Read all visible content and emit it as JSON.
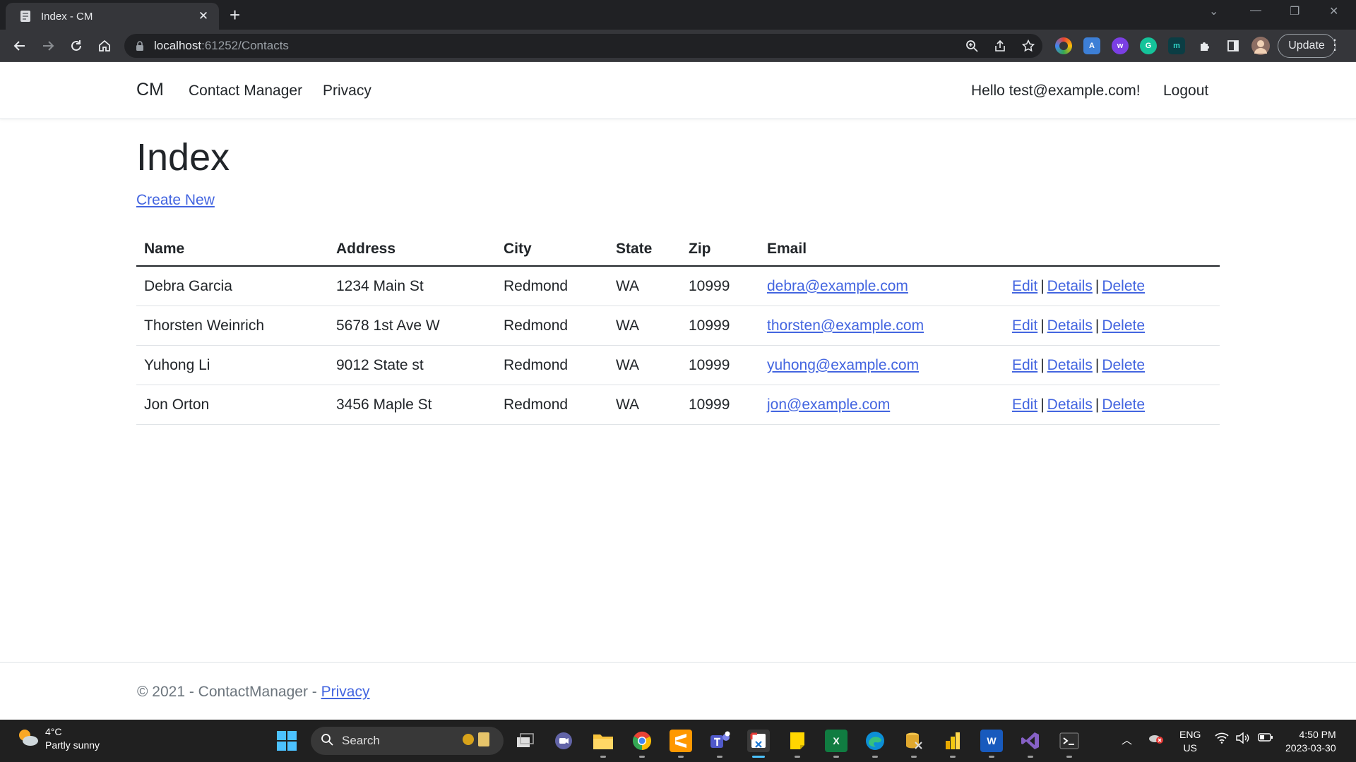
{
  "browser": {
    "tab_title": "Index - CM",
    "url_host": "localhost",
    "url_path": ":61252/Contacts",
    "update_label": "Update"
  },
  "site": {
    "brand": "CM",
    "nav": [
      "Contact Manager",
      "Privacy"
    ],
    "greeting": "Hello test@example.com!",
    "logout": "Logout"
  },
  "page": {
    "title": "Index",
    "create_new": "Create New",
    "columns": [
      "Name",
      "Address",
      "City",
      "State",
      "Zip",
      "Email"
    ],
    "contacts": [
      {
        "name": "Debra Garcia",
        "address": "1234 Main St",
        "city": "Redmond",
        "state": "WA",
        "zip": "10999",
        "email": "debra@example.com"
      },
      {
        "name": "Thorsten Weinrich",
        "address": "5678 1st Ave W",
        "city": "Redmond",
        "state": "WA",
        "zip": "10999",
        "email": "thorsten@example.com"
      },
      {
        "name": "Yuhong Li",
        "address": "9012 State st",
        "city": "Redmond",
        "state": "WA",
        "zip": "10999",
        "email": "yuhong@example.com"
      },
      {
        "name": "Jon Orton",
        "address": "3456 Maple St",
        "city": "Redmond",
        "state": "WA",
        "zip": "10999",
        "email": "jon@example.com"
      }
    ],
    "actions": {
      "edit": "Edit",
      "details": "Details",
      "delete": "Delete",
      "separator": "|"
    }
  },
  "footer": {
    "text": "© 2021 - ContactManager - ",
    "privacy": "Privacy"
  },
  "taskbar": {
    "temperature": "4°C",
    "weather": "Partly sunny",
    "search_label": "Search",
    "lang_top": "ENG",
    "lang_bottom": "US",
    "time": "4:50 PM",
    "date": "2023-03-30",
    "excel_glyph": "X",
    "word_glyph": "W"
  },
  "colors": {
    "link": "#4365e0",
    "chrome_dark": "#202124",
    "chrome_toolbar": "#35363a",
    "taskbar": "#202020"
  }
}
